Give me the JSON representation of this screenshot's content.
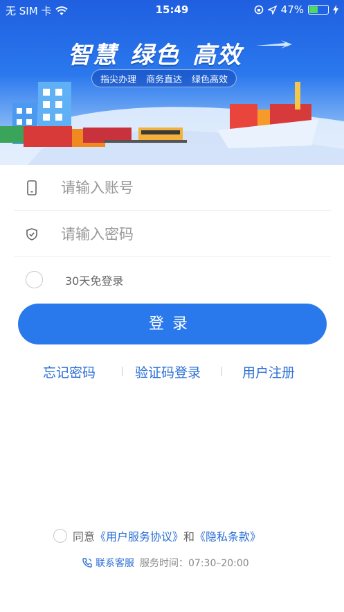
{
  "status_bar": {
    "carrier": "无 SIM 卡",
    "time": "15:49",
    "battery_percent": "47%",
    "battery_level": 0.47,
    "icons": [
      "wifi-icon",
      "rotation-lock-icon",
      "location-arrow-icon",
      "battery-icon"
    ]
  },
  "banner": {
    "slogan": [
      "智慧",
      "绿色",
      "高效"
    ],
    "tags": [
      "指尖办理",
      "商务直达",
      "绿色高效"
    ]
  },
  "form": {
    "account_placeholder": "请输入账号",
    "password_placeholder": "请输入密码",
    "remember_label": "30天免登录",
    "login_label": "登录"
  },
  "links": {
    "forgot": "忘记密码",
    "sms_login": "验证码登录",
    "register": "用户注册"
  },
  "agreement": {
    "prefix": "同意",
    "user_agreement": "《用户服务协议》",
    "and": "和",
    "privacy": "《隐私条款》"
  },
  "service": {
    "contact": "联系客服",
    "hours_label": "服务时间：07:30–20:00"
  },
  "colors": {
    "primary": "#2a79ec",
    "link": "#2a6fd6",
    "banner_top": "#1f5fe0"
  }
}
